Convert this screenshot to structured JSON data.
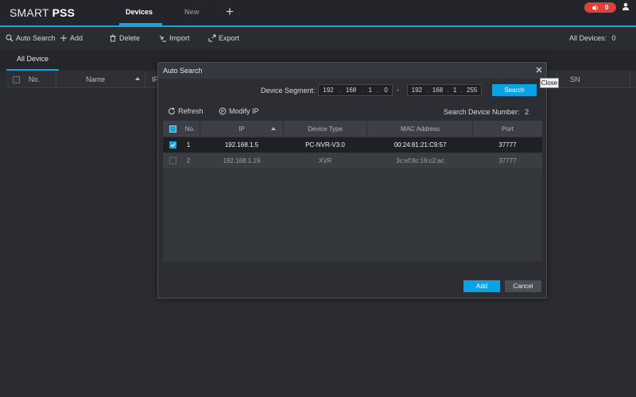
{
  "app": {
    "logo_prefix": "SMART",
    "logo_suffix": "PSS",
    "tabs": [
      {
        "label": "Devices"
      },
      {
        "label": "New"
      }
    ],
    "add_tab_glyph": "+",
    "alarm_count": "0"
  },
  "toolbar": {
    "auto_search": "Auto Search",
    "add": "Add",
    "delete": "Delete",
    "import": "Import",
    "export": "Export",
    "all_devices_label": "All Devices:",
    "all_devices_count": "0"
  },
  "device_list": {
    "tab_label": "All Device",
    "columns": {
      "no": "No.",
      "name": "Name",
      "ip_partial": "IP",
      "sn": "SN"
    }
  },
  "modal": {
    "title": "Auto Search",
    "tooltip": "Close",
    "segment_label": "Device Segment:",
    "start_ip": [
      "192",
      "168",
      "1",
      "0"
    ],
    "end_ip": [
      "192",
      "168",
      "1",
      "255"
    ],
    "range_separator": "-",
    "search_button": "Search",
    "refresh": "Refresh",
    "modify_ip": "Modify IP",
    "search_count_label": "Search Device Number:",
    "search_count": "2",
    "columns": {
      "no": "No.",
      "ip": "IP",
      "device_type": "Device Type",
      "mac": "MAC Address",
      "port": "Port"
    },
    "rows": [
      {
        "no": "1",
        "ip": "192.168.1.5",
        "device_type": "PC-NVR-V3.0",
        "mac": "00:24:81:21:C9:57",
        "port": "37777",
        "checked": true
      },
      {
        "no": "2",
        "ip": "192.168.1.19",
        "device_type": "XVR",
        "mac": "3c:ef:8c:16:c2:ac",
        "port": "37777",
        "checked": false
      }
    ],
    "add_button": "Add",
    "cancel_button": "Cancel"
  },
  "colors": {
    "accent": "#1aa1e0",
    "button_blue": "#0aa2e6",
    "alarm_red": "#e0403a",
    "background": "#2a2c30"
  },
  "icons": [
    "speaker-icon",
    "user-icon",
    "search-icon",
    "plus-icon",
    "trash-icon",
    "import-icon",
    "export-icon",
    "close-icon",
    "refresh-icon",
    "modify-ip-icon",
    "checkbox-icon",
    "sort-arrow-icon"
  ]
}
